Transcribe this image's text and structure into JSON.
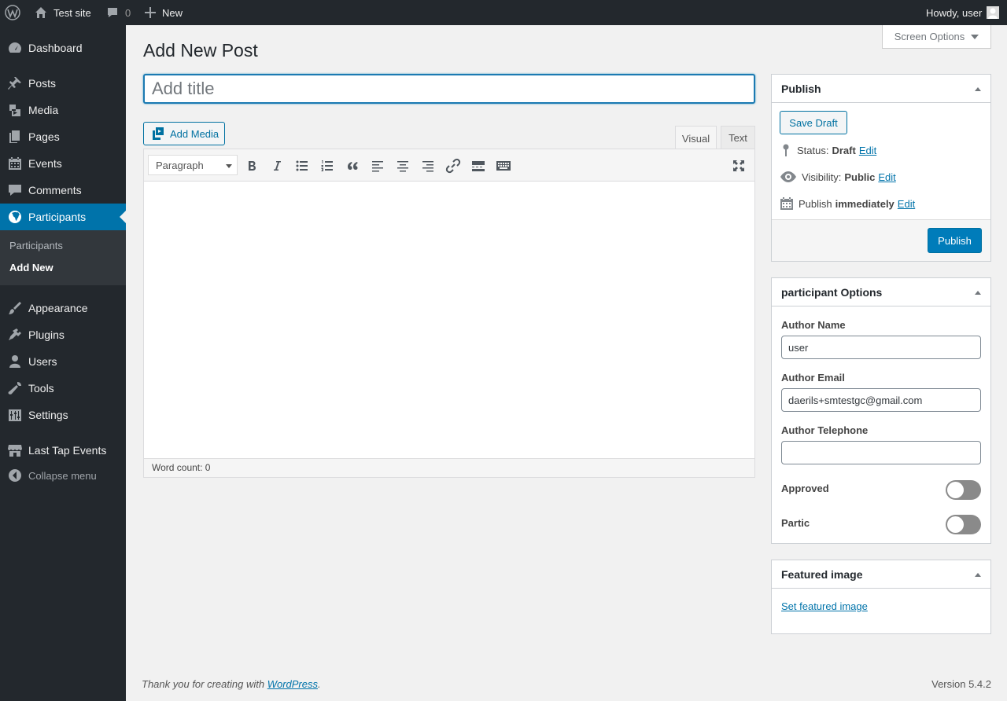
{
  "adminbar": {
    "site_name": "Test site",
    "comments_count": "0",
    "new_label": "New",
    "howdy": "Howdy, user"
  },
  "menu": {
    "items": [
      {
        "label": "Dashboard",
        "icon": "dashboard-icon"
      },
      {
        "label": "Posts",
        "icon": "pin-icon"
      },
      {
        "label": "Media",
        "icon": "media-icon"
      },
      {
        "label": "Pages",
        "icon": "pages-icon"
      },
      {
        "label": "Events",
        "icon": "calendar-icon"
      },
      {
        "label": "Comments",
        "icon": "comment-icon"
      },
      {
        "label": "Participants",
        "icon": "globe-icon"
      },
      {
        "label": "Appearance",
        "icon": "brush-icon"
      },
      {
        "label": "Plugins",
        "icon": "plugin-icon"
      },
      {
        "label": "Users",
        "icon": "user-icon"
      },
      {
        "label": "Tools",
        "icon": "wrench-icon"
      },
      {
        "label": "Settings",
        "icon": "settings-icon"
      },
      {
        "label": "Last Tap Events",
        "icon": "store-icon"
      }
    ],
    "submenu": [
      "Participants",
      "Add New"
    ],
    "collapse_label": "Collapse menu"
  },
  "screen_options_label": "Screen Options",
  "page_title": "Add New Post",
  "title_placeholder": "Add title",
  "editor": {
    "add_media_label": "Add Media",
    "tab_visual": "Visual",
    "tab_text": "Text",
    "format_value": "Paragraph",
    "word_count": "Word count: 0"
  },
  "publish_box": {
    "title": "Publish",
    "save_draft": "Save Draft",
    "status_label": "Status:",
    "status_value": "Draft",
    "visibility_label": "Visibility:",
    "visibility_value": "Public",
    "publish_label": "Publish",
    "publish_value": "immediately",
    "edit_label": "Edit",
    "publish_button": "Publish"
  },
  "participant_box": {
    "title": "participant Options",
    "author_name_label": "Author Name",
    "author_name_value": "user",
    "author_email_label": "Author Email",
    "author_email_value": "daerils+smtestgc@gmail.com",
    "author_phone_label": "Author Telephone",
    "author_phone_value": "",
    "approved_label": "Approved",
    "approved": false,
    "partic_label": "Partic",
    "partic": false
  },
  "featured_box": {
    "title": "Featured image",
    "link": "Set featured image"
  },
  "footer": {
    "thanks_prefix": "Thank you for creating with",
    "thanks_link": "WordPress",
    "thanks_suffix": ".",
    "version": "Version 5.4.2"
  },
  "colors": {
    "accent": "#0073aa",
    "menu_bg": "#23282d",
    "submenu_bg": "#32373c",
    "button_primary": "#007cba"
  }
}
